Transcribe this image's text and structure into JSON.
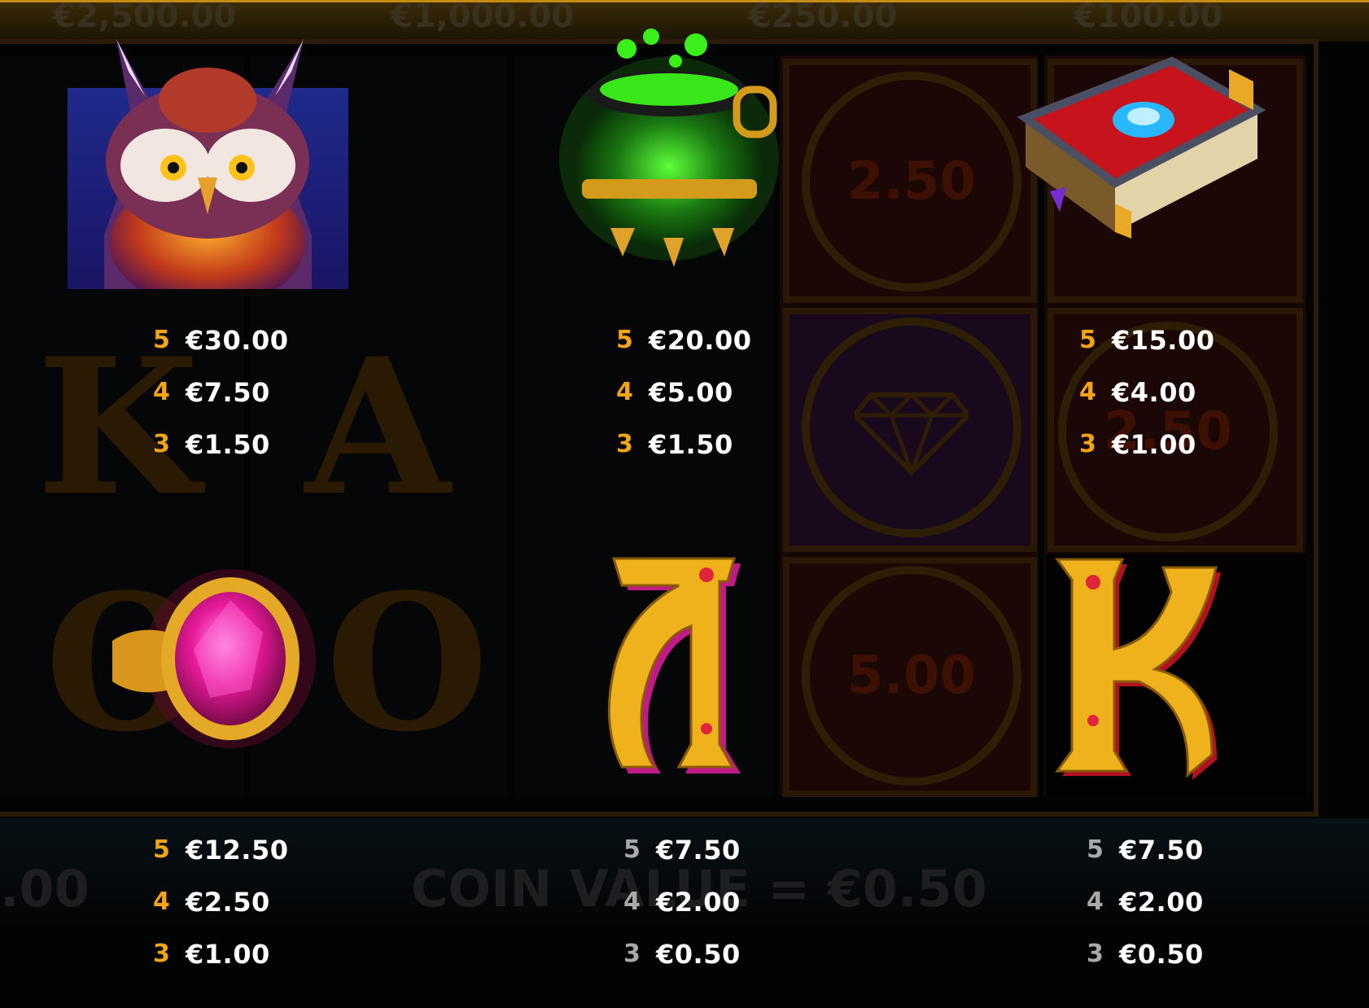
{
  "jackpots": [
    {
      "label": "€2,500.00"
    },
    {
      "label": "€1,000.00"
    },
    {
      "label": "€250.00"
    },
    {
      "label": "€100.00"
    }
  ],
  "board_coins": [
    "2.50",
    "5.00",
    "2.50"
  ],
  "bottom_bar": {
    "coin_value": "COIN VALUE = €0.50",
    "left_value": ".00"
  },
  "symbols": [
    {
      "name": "owl",
      "icon": "owl-icon",
      "payouts": [
        {
          "count": "5",
          "amount": "€30.00"
        },
        {
          "count": "4",
          "amount": "€7.50"
        },
        {
          "count": "3",
          "amount": "€1.50"
        }
      ]
    },
    {
      "name": "cauldron",
      "icon": "cauldron-icon",
      "payouts": [
        {
          "count": "5",
          "amount": "€20.00"
        },
        {
          "count": "4",
          "amount": "€5.00"
        },
        {
          "count": "3",
          "amount": "€1.50"
        }
      ]
    },
    {
      "name": "spellbook",
      "icon": "spellbook-icon",
      "payouts": [
        {
          "count": "5",
          "amount": "€15.00"
        },
        {
          "count": "4",
          "amount": "€4.00"
        },
        {
          "count": "3",
          "amount": "€1.00"
        }
      ]
    },
    {
      "name": "ring",
      "icon": "gem-ring-icon",
      "payouts": [
        {
          "count": "5",
          "amount": "€12.50"
        },
        {
          "count": "4",
          "amount": "€2.50"
        },
        {
          "count": "3",
          "amount": "€1.00"
        }
      ]
    },
    {
      "name": "ace",
      "icon": "letter-a-icon",
      "letter": "A",
      "payouts": [
        {
          "count": "5",
          "amount": "€7.50"
        },
        {
          "count": "4",
          "amount": "€2.00"
        },
        {
          "count": "3",
          "amount": "€0.50"
        }
      ]
    },
    {
      "name": "king",
      "icon": "letter-k-icon",
      "letter": "K",
      "payouts": [
        {
          "count": "5",
          "amount": "€7.50"
        },
        {
          "count": "4",
          "amount": "€2.00"
        },
        {
          "count": "3",
          "amount": "€0.50"
        }
      ]
    }
  ],
  "colors": {
    "count_high": "#f2a415",
    "count_low": "#a9a9a9",
    "amount": "#ffffff",
    "background": "#020303"
  }
}
